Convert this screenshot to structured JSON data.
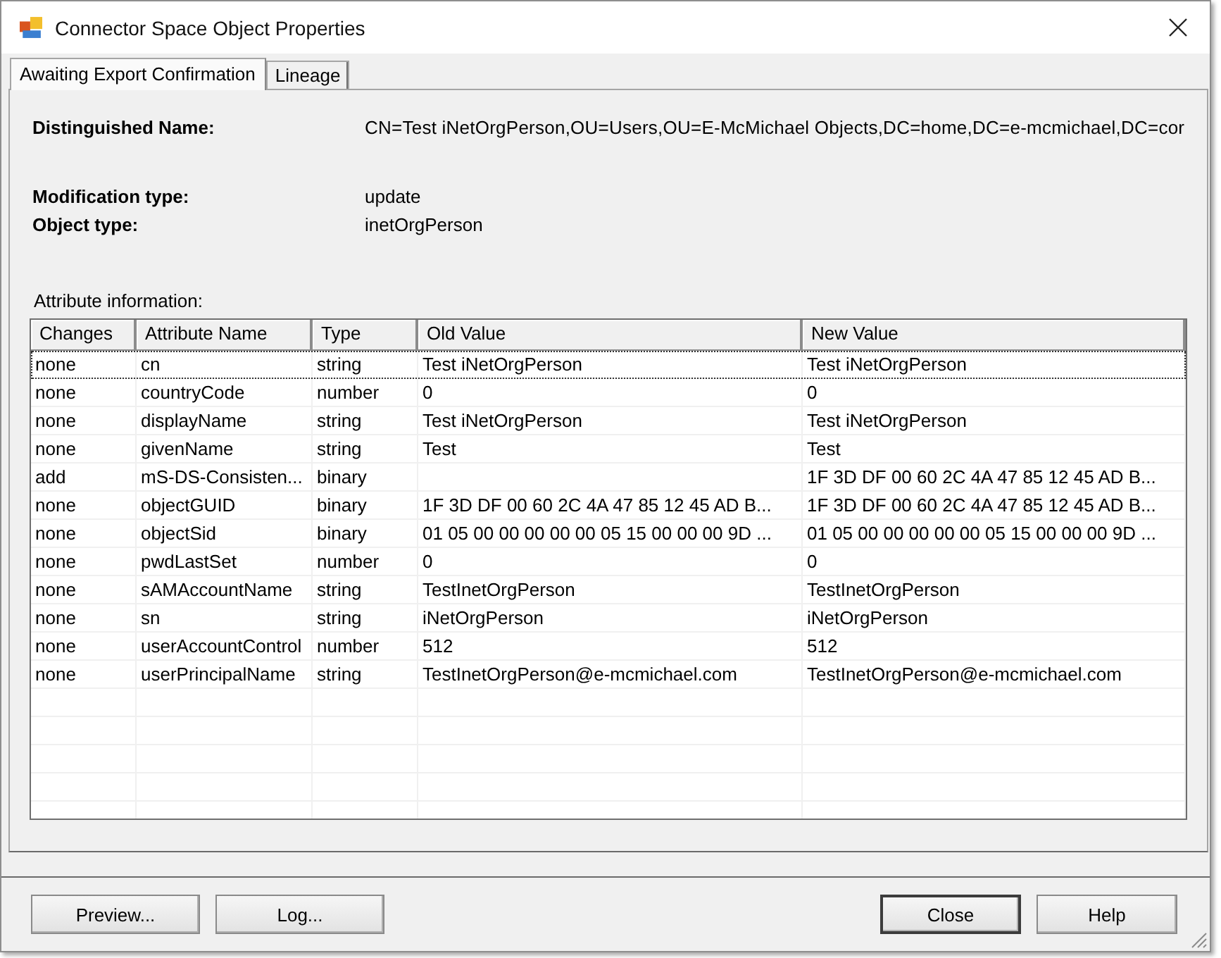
{
  "window": {
    "title": "Connector Space Object Properties"
  },
  "tabs": [
    {
      "label": "Awaiting Export Confirmation",
      "selected": true
    },
    {
      "label": "Lineage",
      "selected": false
    }
  ],
  "distinguished_name": {
    "label": "Distinguished Name:",
    "value": "CN=Test iNetOrgPerson,OU=Users,OU=E-McMichael Objects,DC=home,DC=e-mcmichael,DC=cor"
  },
  "object_info": [
    {
      "label": "Modification type:",
      "value": "update"
    },
    {
      "label": "Object type:",
      "value": "inetOrgPerson"
    }
  ],
  "attribute_table": {
    "caption": "Attribute information:",
    "columns": [
      "Changes",
      "Attribute Name",
      "Type",
      "Old Value",
      "New Value"
    ],
    "rows": [
      {
        "changes": "none",
        "attribute": "cn",
        "type": "string",
        "old_value": "Test iNetOrgPerson",
        "new_value": "Test iNetOrgPerson",
        "focused": true
      },
      {
        "changes": "none",
        "attribute": "countryCode",
        "type": "number",
        "old_value": "0",
        "new_value": "0",
        "focused": false
      },
      {
        "changes": "none",
        "attribute": "displayName",
        "type": "string",
        "old_value": "Test iNetOrgPerson",
        "new_value": "Test iNetOrgPerson",
        "focused": false
      },
      {
        "changes": "none",
        "attribute": "givenName",
        "type": "string",
        "old_value": "Test",
        "new_value": "Test",
        "focused": false
      },
      {
        "changes": "add",
        "attribute": "mS-DS-Consisten...",
        "type": "binary",
        "new_value": "1F 3D DF 00 60 2C 4A 47 85 12 45 AD B...",
        "focused": false
      },
      {
        "changes": "none",
        "attribute": "objectGUID",
        "type": "binary",
        "old_value": "1F 3D DF 00 60 2C 4A 47 85 12 45 AD B...",
        "new_value": "1F 3D DF 00 60 2C 4A 47 85 12 45 AD B...",
        "focused": false
      },
      {
        "changes": "none",
        "attribute": "objectSid",
        "type": "binary",
        "old_value": "01 05 00 00 00 00 00 05 15 00 00 00 9D ...",
        "new_value": "01 05 00 00 00 00 00 05 15 00 00 00 9D ...",
        "focused": false
      },
      {
        "changes": "none",
        "attribute": "pwdLastSet",
        "type": "number",
        "old_value": "0",
        "new_value": "0",
        "focused": false
      },
      {
        "changes": "none",
        "attribute": "sAMAccountName",
        "type": "string",
        "old_value": "TestInetOrgPerson",
        "new_value": "TestInetOrgPerson",
        "focused": false
      },
      {
        "changes": "none",
        "attribute": "sn",
        "type": "string",
        "old_value": "iNetOrgPerson",
        "new_value": "iNetOrgPerson",
        "focused": false
      },
      {
        "changes": "none",
        "attribute": "userAccountControl",
        "type": "number",
        "old_value": "512",
        "new_value": "512",
        "focused": false
      },
      {
        "changes": "none",
        "attribute": "userPrincipalName",
        "type": "string",
        "old_value": "TestInetOrgPerson@e-mcmichael.com",
        "new_value": "TestInetOrgPerson@e-mcmichael.com",
        "focused": false
      }
    ]
  },
  "footer": {
    "left_buttons": [
      {
        "label": "Preview...",
        "default": false
      },
      {
        "label": "Log...",
        "default": false
      }
    ],
    "right_buttons": [
      {
        "label": "Close",
        "default": true
      },
      {
        "label": "Help",
        "default": false
      }
    ]
  }
}
